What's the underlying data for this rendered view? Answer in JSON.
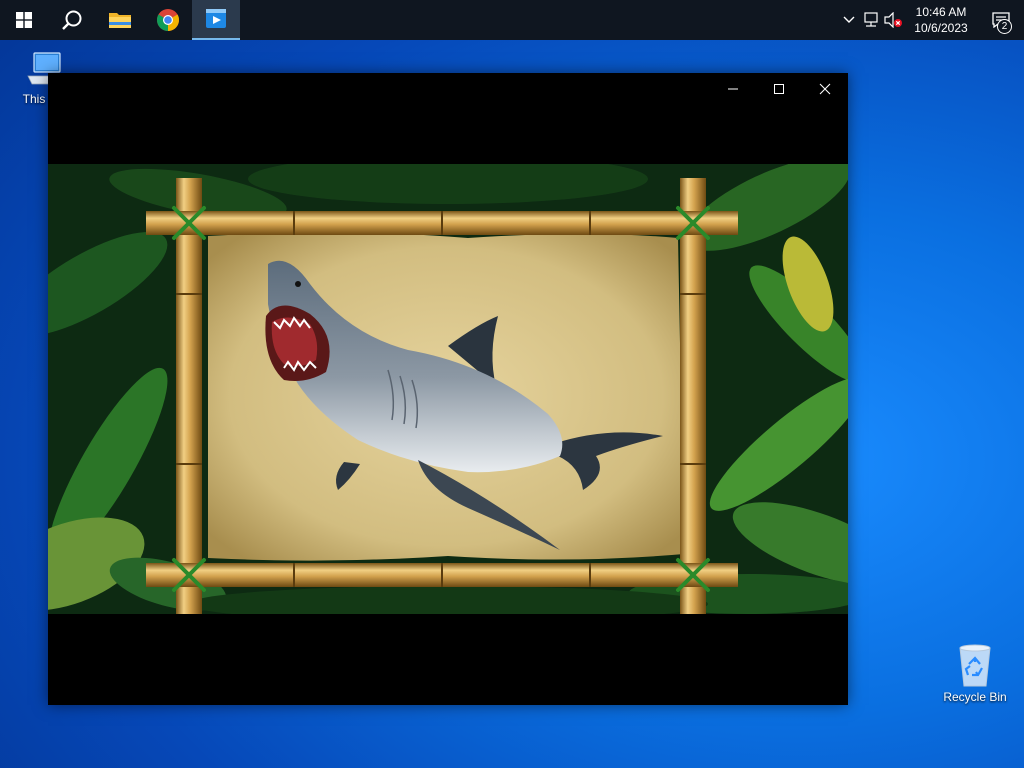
{
  "desktop": {
    "this_pc_label": "This PC",
    "recycle_bin_label": "Recycle Bin"
  },
  "taskbar": {
    "apps": [
      {
        "name": "start-button",
        "icon": "windows-logo-icon"
      },
      {
        "name": "search-button",
        "icon": "search-icon"
      },
      {
        "name": "file-explorer",
        "icon": "folder-icon"
      },
      {
        "name": "chrome",
        "icon": "chrome-icon"
      },
      {
        "name": "media-app",
        "icon": "media-player-icon",
        "active": true
      }
    ],
    "tray": {
      "time": "10:46 AM",
      "date": "10/6/2023",
      "notification_count": "2"
    }
  },
  "window": {
    "controls": [
      "minimize",
      "maximize",
      "close"
    ],
    "content": "shark-in-bamboo-frame-jungle"
  },
  "colors": {
    "taskbar_bg": "#0f1620",
    "desktop_accent": "#0a6fe0",
    "window_bg": "#000000",
    "bamboo": "#c89a48",
    "parchment": "#d9c58c"
  }
}
